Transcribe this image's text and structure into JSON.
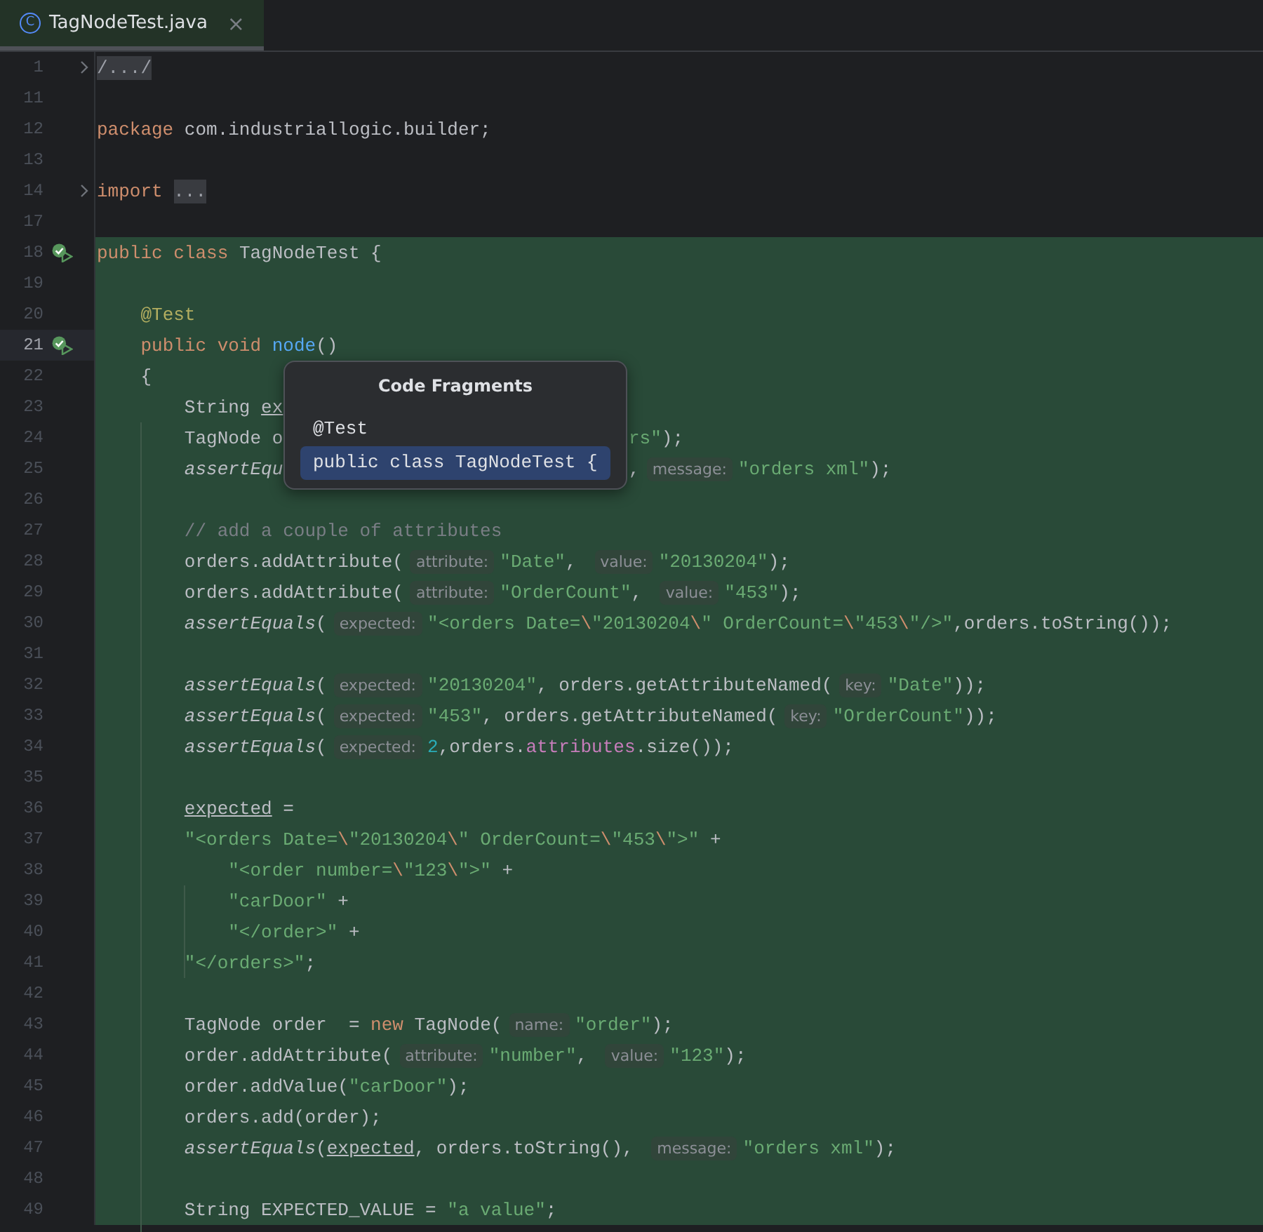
{
  "tabs": [
    {
      "icon": "C",
      "title": "TagNodeTest.java",
      "close": "×",
      "selected": true
    }
  ],
  "editor": {
    "lines": [
      {
        "number": "1",
        "fold": true,
        "highlighted": false,
        "current": false,
        "tokens": [
          {
            "kind": "folded",
            "text": "/.../"
          }
        ]
      },
      {
        "number": "11",
        "highlighted": false,
        "current": false
      },
      {
        "number": "12",
        "highlighted": false,
        "current": false,
        "tokens": [
          {
            "kind": "keyword",
            "text": "package"
          },
          {
            "kind": "plain",
            "text": " com.industriallogic.builder;"
          }
        ]
      },
      {
        "number": "13",
        "highlighted": false,
        "current": false
      },
      {
        "number": "14",
        "fold": true,
        "highlighted": false,
        "current": false,
        "tokens": [
          {
            "kind": "keyword",
            "text": "import"
          },
          {
            "kind": "folded",
            "text": " ..."
          }
        ]
      },
      {
        "number": "17",
        "highlighted": false,
        "current": false
      },
      {
        "number": "18",
        "test_passed": true,
        "highlighted": true,
        "current": false,
        "tokens": [
          {
            "kind": "keyword",
            "text": "public class"
          },
          {
            "kind": "plain",
            "text": " TagNodeTest {"
          }
        ]
      },
      {
        "number": "19",
        "highlighted": true,
        "current": false
      },
      {
        "number": "20",
        "highlighted": true,
        "current": false,
        "tokens": [
          {
            "kind": "annotation",
            "text": "    @Test"
          }
        ]
      },
      {
        "number": "21",
        "test_passed": true,
        "highlighted": true,
        "current": true,
        "tokens": [
          {
            "kind": "keyword",
            "text": "    public void"
          },
          {
            "kind": "method",
            "text": " node"
          },
          {
            "kind": "plain",
            "text": "()"
          }
        ]
      },
      {
        "number": "22",
        "highlighted": true,
        "current": false,
        "tokens": [
          {
            "kind": "plain",
            "text": "    {"
          }
        ]
      },
      {
        "number": "23",
        "highlighted": true,
        "current": false,
        "tokens": [
          {
            "kind": "plain",
            "text": "        String"
          },
          {
            "kind": "local",
            "text": " ex"
          }
        ]
      },
      {
        "number": "24",
        "highlighted": true,
        "current": false,
        "tokens": [
          {
            "kind": "plain",
            "text": "        TagNode o"
          }
        ],
        "after_popup": [
          {
            "kind": "string",
            "text": "rs\""
          },
          {
            "kind": "plain",
            "text": ");"
          }
        ]
      },
      {
        "number": "25",
        "highlighted": true,
        "current": false,
        "tokens": [
          {
            "kind": "static",
            "text": "        assertEqu"
          }
        ],
        "after_popup": [
          {
            "kind": "plain",
            "text": ","
          },
          {
            "kind": "hint",
            "text": "message:"
          },
          {
            "kind": "string",
            "text": "\"orders xml\""
          },
          {
            "kind": "plain",
            "text": ");"
          }
        ]
      },
      {
        "number": "26",
        "highlighted": true,
        "current": false
      },
      {
        "number": "27",
        "highlighted": true,
        "current": false,
        "tokens": [
          {
            "kind": "comment",
            "text": "        // add a couple of attributes"
          }
        ]
      },
      {
        "number": "28",
        "highlighted": true,
        "current": false,
        "tokens": [
          {
            "kind": "plain",
            "text": "        orders.addAttribute("
          },
          {
            "kind": "hint",
            "text": "attribute:"
          },
          {
            "kind": "string",
            "text": "\"Date\""
          },
          {
            "kind": "plain",
            "text": ", "
          },
          {
            "kind": "hint",
            "text": "value:"
          },
          {
            "kind": "string",
            "text": "\"20130204\""
          },
          {
            "kind": "plain",
            "text": ");"
          }
        ]
      },
      {
        "number": "29",
        "highlighted": true,
        "current": false,
        "tokens": [
          {
            "kind": "plain",
            "text": "        orders.addAttribute("
          },
          {
            "kind": "hint",
            "text": "attribute:"
          },
          {
            "kind": "string",
            "text": "\"OrderCount\""
          },
          {
            "kind": "plain",
            "text": ", "
          },
          {
            "kind": "hint",
            "text": "value:"
          },
          {
            "kind": "string",
            "text": "\"453\""
          },
          {
            "kind": "plain",
            "text": ");"
          }
        ]
      },
      {
        "number": "30",
        "highlighted": true,
        "current": false,
        "tokens": [
          {
            "kind": "static",
            "text": "        assertEquals"
          },
          {
            "kind": "plain",
            "text": "("
          },
          {
            "kind": "hint",
            "text": "expected:"
          },
          {
            "kind": "string",
            "text": "\"<orders Date="
          },
          {
            "kind": "escape",
            "text": "\\"
          },
          {
            "kind": "string",
            "text": "\"20130204"
          },
          {
            "kind": "escape",
            "text": "\\"
          },
          {
            "kind": "string",
            "text": "\" OrderCount="
          },
          {
            "kind": "escape",
            "text": "\\"
          },
          {
            "kind": "string",
            "text": "\"453"
          },
          {
            "kind": "escape",
            "text": "\\"
          },
          {
            "kind": "string",
            "text": "\"/>\""
          },
          {
            "kind": "plain",
            "text": ",orders.toString());"
          }
        ]
      },
      {
        "number": "31",
        "highlighted": true,
        "current": false
      },
      {
        "number": "32",
        "highlighted": true,
        "current": false,
        "tokens": [
          {
            "kind": "static",
            "text": "        assertEquals"
          },
          {
            "kind": "plain",
            "text": "("
          },
          {
            "kind": "hint",
            "text": "expected:"
          },
          {
            "kind": "string",
            "text": "\"20130204\""
          },
          {
            "kind": "plain",
            "text": ", orders.getAttributeNamed("
          },
          {
            "kind": "hint",
            "text": "key:"
          },
          {
            "kind": "string",
            "text": "\"Date\""
          },
          {
            "kind": "plain",
            "text": "));"
          }
        ]
      },
      {
        "number": "33",
        "highlighted": true,
        "current": false,
        "tokens": [
          {
            "kind": "static",
            "text": "        assertEquals"
          },
          {
            "kind": "plain",
            "text": "("
          },
          {
            "kind": "hint",
            "text": "expected:"
          },
          {
            "kind": "string",
            "text": "\"453\""
          },
          {
            "kind": "plain",
            "text": ", orders.getAttributeNamed("
          },
          {
            "kind": "hint",
            "text": "key:"
          },
          {
            "kind": "string",
            "text": "\"OrderCount\""
          },
          {
            "kind": "plain",
            "text": "));"
          }
        ]
      },
      {
        "number": "34",
        "highlighted": true,
        "current": false,
        "tokens": [
          {
            "kind": "static",
            "text": "        assertEquals"
          },
          {
            "kind": "plain",
            "text": "("
          },
          {
            "kind": "hint",
            "text": "expected:"
          },
          {
            "kind": "number",
            "text": "2"
          },
          {
            "kind": "plain",
            "text": ",orders."
          },
          {
            "kind": "field",
            "text": "attributes"
          },
          {
            "kind": "plain",
            "text": ".size());"
          }
        ]
      },
      {
        "number": "35",
        "highlighted": true,
        "current": false
      },
      {
        "number": "36",
        "highlighted": true,
        "current": false,
        "tokens": [
          {
            "kind": "local",
            "text": "        expected"
          },
          {
            "kind": "plain",
            "text": " ="
          }
        ]
      },
      {
        "number": "37",
        "highlighted": true,
        "current": false,
        "tokens": [
          {
            "kind": "string",
            "text": "        \"<orders Date="
          },
          {
            "kind": "escape",
            "text": "\\"
          },
          {
            "kind": "string",
            "text": "\"20130204"
          },
          {
            "kind": "escape",
            "text": "\\"
          },
          {
            "kind": "string",
            "text": "\" OrderCount="
          },
          {
            "kind": "escape",
            "text": "\\"
          },
          {
            "kind": "string",
            "text": "\"453"
          },
          {
            "kind": "escape",
            "text": "\\"
          },
          {
            "kind": "string",
            "text": "\">\""
          },
          {
            "kind": "plain",
            "text": " +"
          }
        ]
      },
      {
        "number": "38",
        "highlighted": true,
        "current": false,
        "tokens": [
          {
            "kind": "string",
            "text": "            \"<order number="
          },
          {
            "kind": "escape",
            "text": "\\"
          },
          {
            "kind": "string",
            "text": "\"123"
          },
          {
            "kind": "escape",
            "text": "\\"
          },
          {
            "kind": "string",
            "text": "\">\""
          },
          {
            "kind": "plain",
            "text": " +"
          }
        ]
      },
      {
        "number": "39",
        "highlighted": true,
        "current": false,
        "tokens": [
          {
            "kind": "string",
            "text": "            \"carDoor\""
          },
          {
            "kind": "plain",
            "text": " +"
          }
        ]
      },
      {
        "number": "40",
        "highlighted": true,
        "current": false,
        "tokens": [
          {
            "kind": "string",
            "text": "            \"</order>\""
          },
          {
            "kind": "plain",
            "text": " +"
          }
        ]
      },
      {
        "number": "41",
        "highlighted": true,
        "current": false,
        "tokens": [
          {
            "kind": "string",
            "text": "        \"</orders>\""
          },
          {
            "kind": "plain",
            "text": ";"
          }
        ]
      },
      {
        "number": "42",
        "highlighted": true,
        "current": false
      },
      {
        "number": "43",
        "highlighted": true,
        "current": false,
        "tokens": [
          {
            "kind": "plain",
            "text": "        TagNode order  = "
          },
          {
            "kind": "keyword",
            "text": "new"
          },
          {
            "kind": "plain",
            "text": " TagNode("
          },
          {
            "kind": "hint",
            "text": "name:"
          },
          {
            "kind": "string",
            "text": "\"order\""
          },
          {
            "kind": "plain",
            "text": ");"
          }
        ]
      },
      {
        "number": "44",
        "highlighted": true,
        "current": false,
        "tokens": [
          {
            "kind": "plain",
            "text": "        order.addAttribute("
          },
          {
            "kind": "hint",
            "text": "attribute:"
          },
          {
            "kind": "string",
            "text": "\"number\""
          },
          {
            "kind": "plain",
            "text": ", "
          },
          {
            "kind": "hint",
            "text": "value:"
          },
          {
            "kind": "string",
            "text": "\"123\""
          },
          {
            "kind": "plain",
            "text": ");"
          }
        ]
      },
      {
        "number": "45",
        "highlighted": true,
        "current": false,
        "tokens": [
          {
            "kind": "plain",
            "text": "        order.addValue("
          },
          {
            "kind": "string",
            "text": "\"carDoor\""
          },
          {
            "kind": "plain",
            "text": ");"
          }
        ]
      },
      {
        "number": "46",
        "highlighted": true,
        "current": false,
        "tokens": [
          {
            "kind": "plain",
            "text": "        orders.add(order);"
          }
        ]
      },
      {
        "number": "47",
        "highlighted": true,
        "current": false,
        "tokens": [
          {
            "kind": "static",
            "text": "        assertEquals"
          },
          {
            "kind": "plain",
            "text": "("
          },
          {
            "kind": "local",
            "text": "expected"
          },
          {
            "kind": "plain",
            "text": ", orders.toString(), "
          },
          {
            "kind": "hint",
            "text": "message:"
          },
          {
            "kind": "string",
            "text": "\"orders xml\""
          },
          {
            "kind": "plain",
            "text": ");"
          }
        ]
      },
      {
        "number": "48",
        "highlighted": true,
        "current": false
      },
      {
        "number": "49",
        "highlighted": true,
        "current": false,
        "tokens": [
          {
            "kind": "plain",
            "text": "        String EXPECTED_VALUE = "
          },
          {
            "kind": "string",
            "text": "\"a value\""
          },
          {
            "kind": "plain",
            "text": ";"
          }
        ]
      }
    ]
  },
  "popup": {
    "title": "Code Fragments",
    "items": [
      {
        "text": "@Test",
        "selected": false
      },
      {
        "text": "public class TagNodeTest {",
        "selected": true
      }
    ]
  }
}
